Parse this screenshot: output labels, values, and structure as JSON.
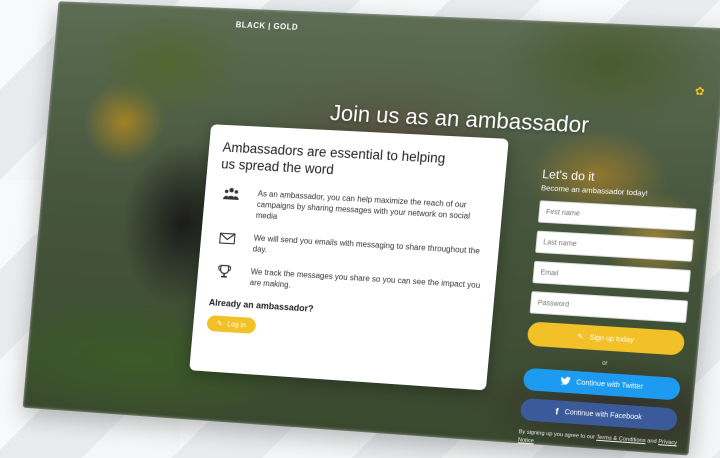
{
  "brand": {
    "logo": "BLACK | GOLD",
    "tagline": ""
  },
  "hero": {
    "headline": "Join us as an ambassador"
  },
  "info_card": {
    "title": "Ambassadors are essential to helping us spread the word",
    "features": [
      {
        "icon": "group-icon",
        "text": "As an ambassador, you can help maximize the reach of our campaigns by sharing messages with your network on social media"
      },
      {
        "icon": "envelope-icon",
        "text": "We will send you emails with messaging to share throughout the day."
      },
      {
        "icon": "trophy-icon",
        "text": "We track the messages you share so you can see the impact you are making."
      }
    ],
    "already_label": "Already an ambassador?",
    "login_label": "Log in"
  },
  "signup_panel": {
    "heading": "Let's do it",
    "subheading": "Become an ambassador today!",
    "first_name_placeholder": "First name",
    "last_name_placeholder": "Last name",
    "email_placeholder": "Email",
    "password_placeholder": "Password",
    "signup_label": "Sign up today",
    "or_label": "or",
    "twitter_label": "Continue with Twitter",
    "facebook_label": "Continue with Facebook",
    "terms_prefix": "By signing up you agree to our",
    "terms_link": "Terms & Conditions",
    "terms_and": "and",
    "privacy_link": "Privacy Notice"
  },
  "colors": {
    "accent": "#f2c027",
    "twitter": "#1d9bf0",
    "facebook": "#3b5a9a"
  }
}
